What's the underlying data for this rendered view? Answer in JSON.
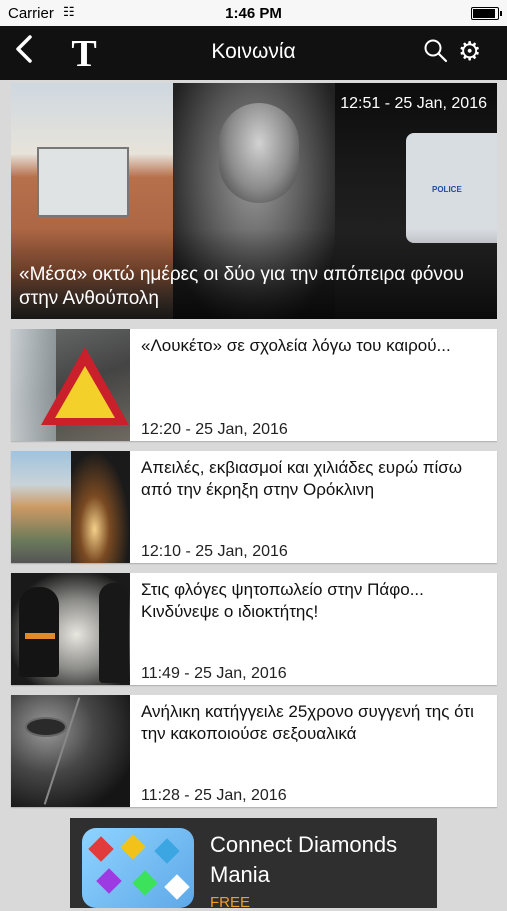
{
  "status_bar": {
    "carrier": "Carrier",
    "time": "1:46 PM"
  },
  "nav": {
    "title": "Κοινωνία",
    "logo": "T",
    "back_icon": "chevron-left-icon",
    "search_icon": "search-icon",
    "settings_icon": "gear-icon"
  },
  "hero": {
    "time": "12:51 - 25 Jan, 2016",
    "headline": "«Μέσα» οκτώ ημέρες οι δύο για την απόπειρα φόνου στην Ανθούπολη",
    "police_text": "POLICE"
  },
  "articles": [
    {
      "title": "«Λουκέτο» σε σχολεία λόγω του καιρού...",
      "time": "12:20 - 25 Jan, 2016"
    },
    {
      "title": "Απειλές, εκβιασμοί και χιλιάδες ευρώ πίσω από την έκρηξη στην Ορόκλινη",
      "time": "12:10 - 25 Jan, 2016"
    },
    {
      "title": "Στις φλόγες ψητοπωλείο στην Πάφο... Κινδύνεψε ο ιδιοκτήτης!",
      "time": "11:49 - 25 Jan, 2016"
    },
    {
      "title": "Ανήλικη κατήγγειλε 25χρονο συγγενή της ότι την κακοποιούσε σεξουαλικά",
      "time": "11:28 - 25 Jan, 2016"
    }
  ],
  "ad": {
    "name": "Connect Diamonds Mania",
    "price": "FREE"
  }
}
